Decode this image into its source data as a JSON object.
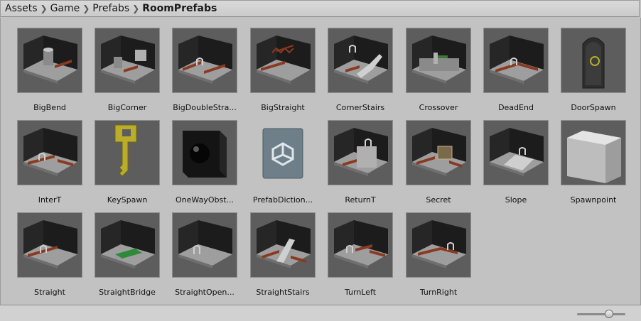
{
  "breadcrumb": [
    "Assets",
    "Game",
    "Prefabs",
    "RoomPrefabs"
  ],
  "items": [
    {
      "name": "BigBend",
      "icon": "room-bigbend-icon"
    },
    {
      "name": "BigCorner",
      "icon": "room-bigcorner-icon"
    },
    {
      "name": "BigDoubleStra...",
      "icon": "room-bigdoublestraight-icon"
    },
    {
      "name": "BigStraight",
      "icon": "room-bigstraight-icon"
    },
    {
      "name": "CornerStairs",
      "icon": "room-cornerstairs-icon"
    },
    {
      "name": "Crossover",
      "icon": "room-crossover-icon"
    },
    {
      "name": "DeadEnd",
      "icon": "room-deadend-icon"
    },
    {
      "name": "DoorSpawn",
      "icon": "door-icon"
    },
    {
      "name": "InterT",
      "icon": "room-intert-icon"
    },
    {
      "name": "KeySpawn",
      "icon": "key-icon"
    },
    {
      "name": "OneWayObst...",
      "icon": "black-cube-sphere-icon"
    },
    {
      "name": "PrefabDiction...",
      "icon": "unity-script-icon"
    },
    {
      "name": "ReturnT",
      "icon": "room-returnt-icon"
    },
    {
      "name": "Secret",
      "icon": "room-secret-icon"
    },
    {
      "name": "Slope",
      "icon": "room-slope-icon"
    },
    {
      "name": "Spawnpoint",
      "icon": "white-cube-icon"
    },
    {
      "name": "Straight",
      "icon": "room-straight-icon"
    },
    {
      "name": "StraightBridge",
      "icon": "room-straightbridge-icon"
    },
    {
      "name": "StraightOpen...",
      "icon": "room-straightopen-icon"
    },
    {
      "name": "StraightStairs",
      "icon": "room-straightstairs-icon"
    },
    {
      "name": "TurnLeft",
      "icon": "room-turnleft-icon"
    },
    {
      "name": "TurnRight",
      "icon": "room-turnright-icon"
    }
  ],
  "zoom_slider": {
    "value": 0.7
  },
  "colors": {
    "background": "#c2c2c2",
    "thumb_bg": "#5d5d5d",
    "floor": "#9e9e9e",
    "wall": "#262626",
    "brick": "#8a3a20",
    "key": "#b9ad2a"
  }
}
